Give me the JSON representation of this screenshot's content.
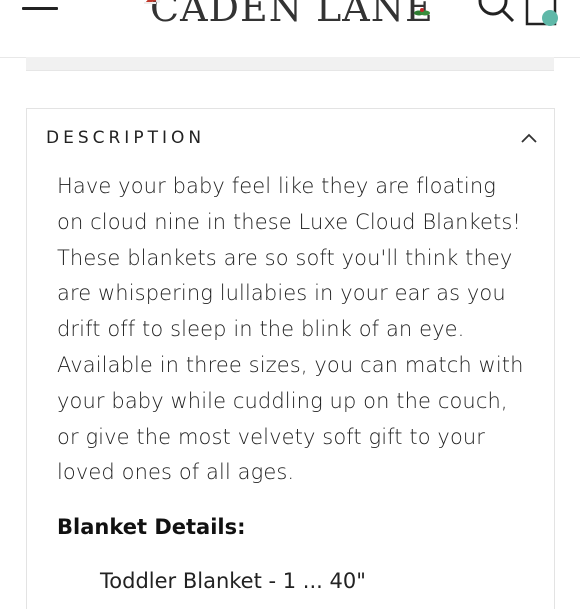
{
  "header": {
    "logo_text": "CADEN LANE",
    "menu_icon": "hamburger-menu-icon",
    "search_icon": "search-icon",
    "cart_icon": "shopping-bag-icon",
    "accent_color": "#5fb8a8"
  },
  "description": {
    "title": "DESCRIPTION",
    "toggle_icon": "chevron-up-icon",
    "paragraph": "Have your baby feel like they are floating on cloud nine in these Luxe Cloud Blankets! These blankets are so soft you'll think they are whispering lullabies in your ear as you drift off to sleep in the blink of an eye. Available in three sizes, you can match with your baby while cuddling up on the couch, or give the most velvety soft gift to your loved ones of all ages.",
    "details_title": "Blanket Details:",
    "details_first_item_partial": "Toddler Blanket - 1 ... 40\""
  }
}
